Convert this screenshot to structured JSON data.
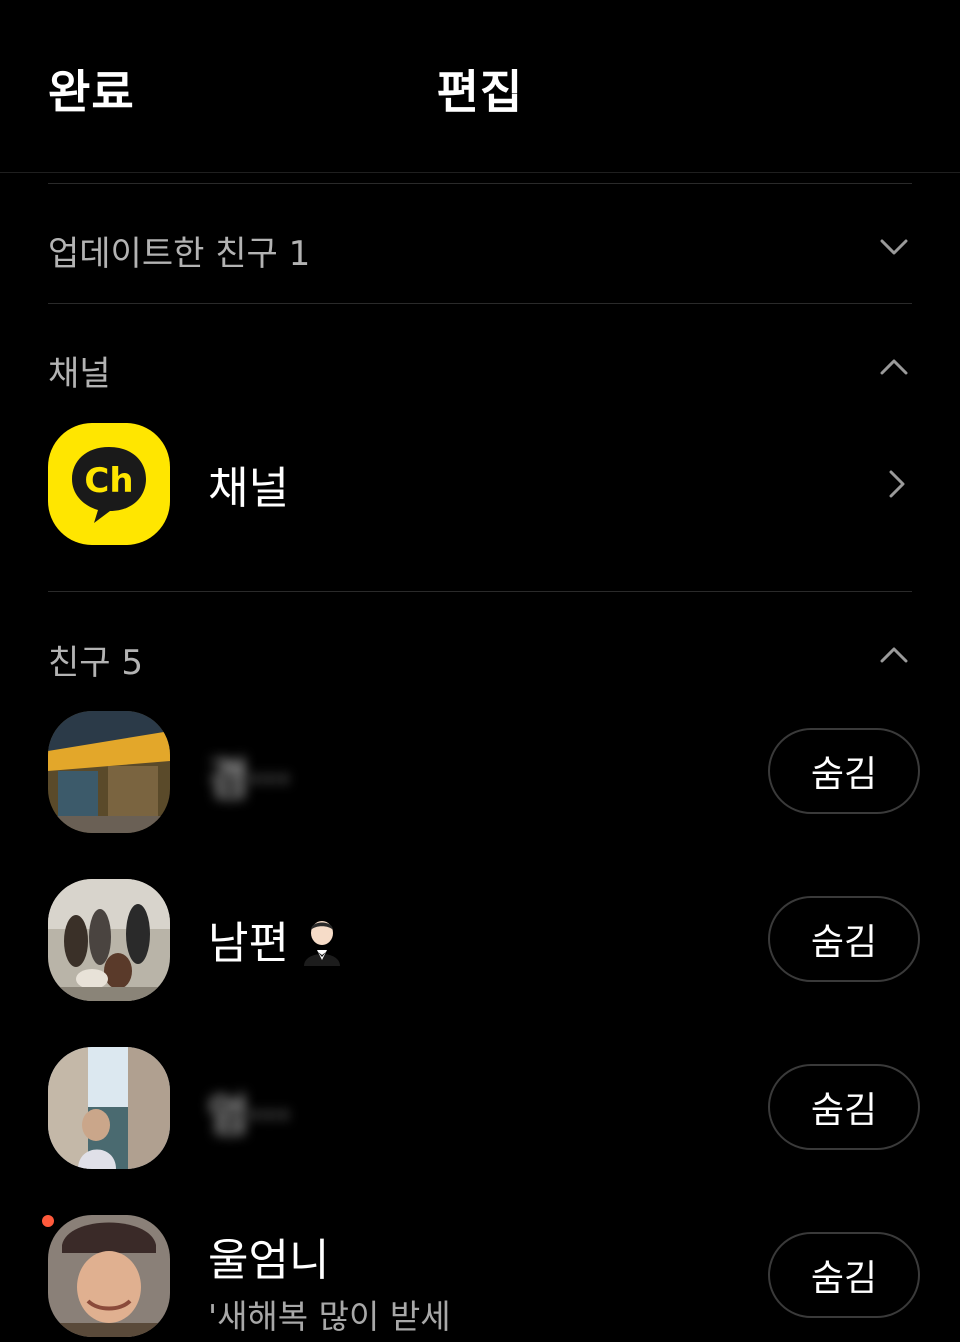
{
  "header": {
    "done_label": "완료",
    "title": "편집"
  },
  "sections": {
    "updated": {
      "label": "업데이트한 친구 1",
      "icon": "chevron-down-icon"
    },
    "channel": {
      "label": "채널",
      "icon": "chevron-up-icon"
    },
    "friends": {
      "label": "친구 5",
      "icon": "chevron-up-icon"
    }
  },
  "channel_item": {
    "name": "채널",
    "logo_text": "Ch",
    "icon": "chevron-right-icon",
    "brand_color": "#ffe600"
  },
  "friends": [
    {
      "name": "겸···",
      "status": "",
      "hide_label": "숨김",
      "blurred": true
    },
    {
      "name": "남편",
      "status": "",
      "hide_label": "숨김",
      "blurred": false
    },
    {
      "name": "엄···",
      "status": "",
      "hide_label": "숨김",
      "blurred": true
    },
    {
      "name": "울엄니",
      "status": "'새해복 많이 받세",
      "hide_label": "숨김",
      "blurred": false,
      "new_badge": true
    }
  ],
  "colors": {
    "background": "#000000",
    "divider": "#2a2a2a",
    "secondary_text": "#b3b3b3",
    "badge": "#ff5a3c"
  }
}
